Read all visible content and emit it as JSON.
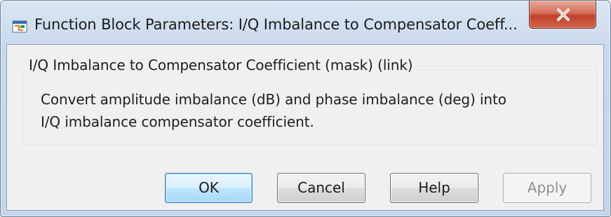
{
  "window": {
    "title": "Function Block Parameters: I/Q Imbalance to Compensator Coeff...",
    "title_icon": "simulink-block-icon",
    "close_icon": "close-x-icon"
  },
  "group": {
    "legend": "I/Q Imbalance to Compensator Coefficient (mask) (link)",
    "description_line1": "Convert amplitude imbalance (dB) and phase imbalance (deg) into",
    "description_line2": "I/Q imbalance compensator coefficient."
  },
  "buttons": {
    "ok": "OK",
    "cancel": "Cancel",
    "help": "Help",
    "apply": "Apply"
  },
  "colors": {
    "frame": "#c4d5ea",
    "close_button": "#c0402a",
    "default_button_border": "#3c7fb1",
    "dialog_background": "#f0f0f0"
  }
}
